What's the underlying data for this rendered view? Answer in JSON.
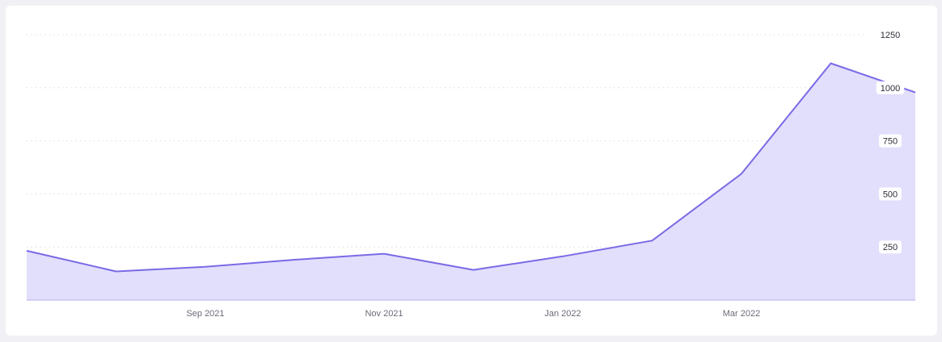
{
  "colors": {
    "line": "#7a6ae6",
    "area": "#e2dffc",
    "grid": "#dcdce4",
    "baseline": "#c9c4f3",
    "card": "#ffffff",
    "background": "#f1f1f5"
  },
  "chart_data": {
    "type": "area",
    "title": "",
    "xlabel": "",
    "ylabel": "",
    "x": [
      "2021-07",
      "2021-08",
      "2021-09",
      "2021-10",
      "2021-11",
      "2021-12",
      "2022-01",
      "2022-02",
      "2022-03",
      "2022-04",
      "2022-05"
    ],
    "series": [
      {
        "values": [
          232,
          135,
          157,
          190,
          218,
          142,
          206,
          280,
          595,
          1115,
          970
        ]
      }
    ],
    "x_tick_labels": [
      {
        "at": "2021-09",
        "label": "Sep 2021"
      },
      {
        "at": "2021-11",
        "label": "Nov 2021"
      },
      {
        "at": "2022-01",
        "label": "Jan 2022"
      },
      {
        "at": "2022-03",
        "label": "Mar 2022"
      }
    ],
    "y_ticks": [
      250,
      500,
      750,
      1000,
      1250
    ],
    "ylim": [
      0,
      1250
    ],
    "y_axis_position": "right",
    "grid": true,
    "grid_style": "dotted"
  }
}
